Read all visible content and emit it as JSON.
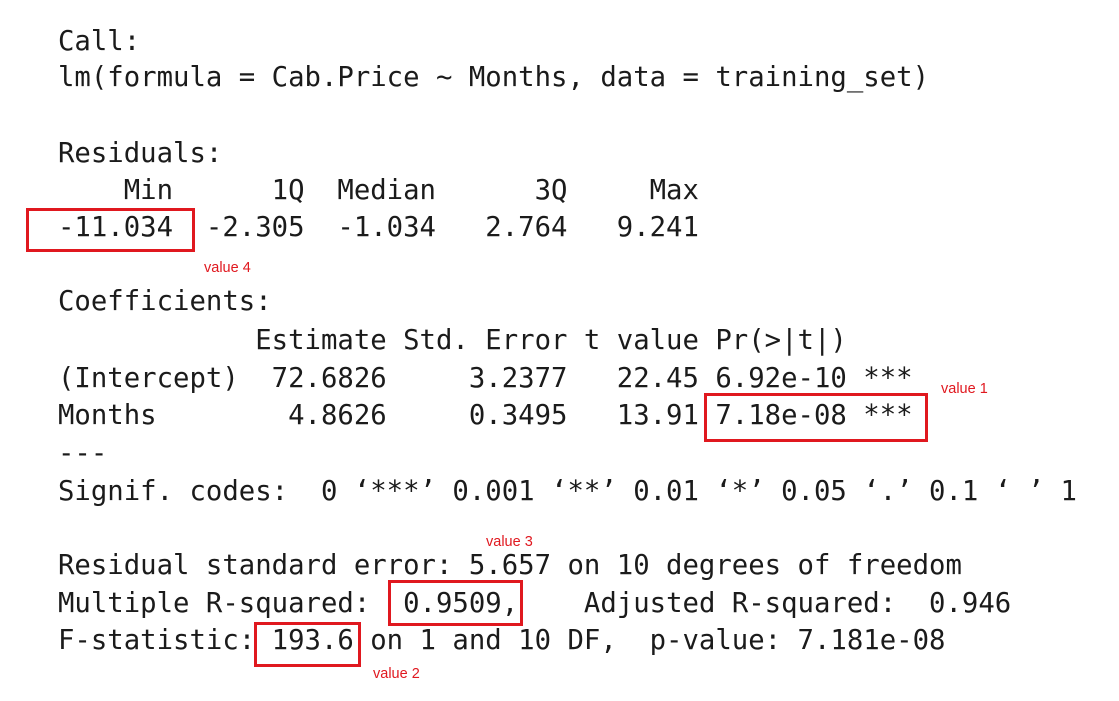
{
  "console": {
    "call_header": "Call:",
    "call": "lm(formula = Cab.Price ~ Months, data = training_set)",
    "residuals_header": "Residuals:",
    "residuals_columns": "    Min      1Q  Median      3Q     Max ",
    "residuals_values": "-11.034  -2.305  -1.034   2.764   9.241 ",
    "coefficients_header": "Coefficients:",
    "coefficients_columns": "            Estimate Std. Error t value Pr(>|t|)    ",
    "coefficient_rows": [
      "(Intercept)  72.6826     3.2377   22.45 6.92e-10 ***",
      "Months        4.8626     0.3495   13.91 7.18e-08 ***"
    ],
    "separator": "---",
    "signif_codes": "Signif. codes:  0 ‘***’ 0.001 ‘**’ 0.01 ‘*’ 0.05 ‘.’ 0.1 ‘ ’ 1",
    "residual_se": "Residual standard error: 5.657 on 10 degrees of freedom",
    "r_squared": "Multiple R-squared:  0.9509,\tAdjusted R-squared:  0.946 ",
    "f_statistic": "F-statistic: 193.6 on 1 and 10 DF,  p-value: 7.181e-08"
  },
  "annotations": {
    "value_1": "value 1",
    "value_2": "value 2",
    "value_3": "value 3",
    "value_4": "value 4",
    "highlight_color": "#e0181f"
  }
}
